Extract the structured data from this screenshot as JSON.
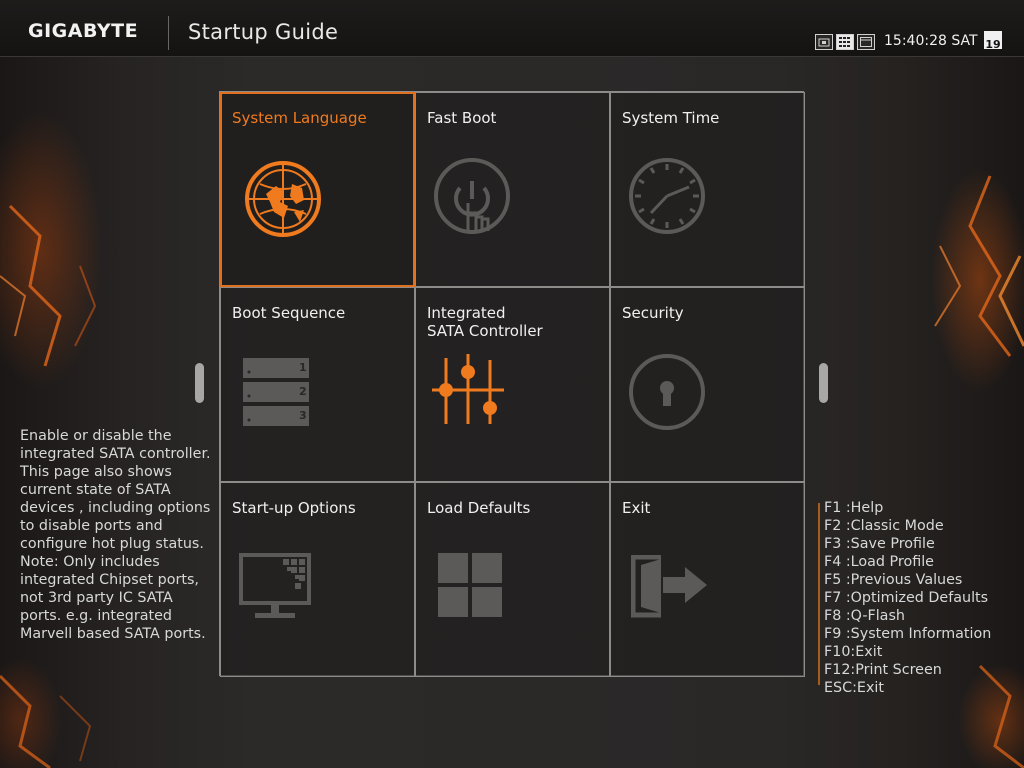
{
  "header": {
    "brand": "GIGABYTE",
    "title": "Startup Guide",
    "time": "15:40:28 SAT",
    "date_day": "19",
    "icons": [
      "screenshot-icon",
      "grid-view-icon",
      "window-view-icon",
      "calendar-icon"
    ]
  },
  "tiles": [
    {
      "label": "System Language",
      "icon": "globe-icon",
      "selected": true
    },
    {
      "label": "Fast Boot",
      "icon": "power-touch-icon",
      "selected": false
    },
    {
      "label": "System Time",
      "icon": "clock-icon",
      "selected": false
    },
    {
      "label": "Boot Sequence",
      "icon": "boot-order-icon",
      "selected": false,
      "items": [
        "1",
        "2",
        "3"
      ]
    },
    {
      "label": "Integrated\nSATA Controller",
      "icon": "sliders-icon",
      "selected": false
    },
    {
      "label": "Security",
      "icon": "lock-icon",
      "selected": false
    },
    {
      "label": "Start-up Options",
      "icon": "monitor-icon",
      "selected": false
    },
    {
      "label": "Load Defaults",
      "icon": "defaults-grid-icon",
      "selected": false
    },
    {
      "label": "Exit",
      "icon": "exit-icon",
      "selected": false
    }
  ],
  "description": [
    "Enable or disable the integrated SATA controller.",
    "This page also shows current state of SATA devices , including options to disable ports and configure hot plug status.",
    "Note: Only includes integrated Chipset ports, not 3rd party IC SATA ports. e.g. integrated Marvell based SATA ports."
  ],
  "hotkeys": [
    "F1 :Help",
    "F2 :Classic Mode",
    "F3 :Save Profile",
    "F4 :Load Profile",
    "F5 :Previous Values",
    "F7 :Optimized Defaults",
    "F8 :Q-Flash",
    "F9 :System Information",
    "F10:Exit",
    "F12:Print Screen",
    "ESC:Exit"
  ],
  "colors": {
    "accent": "#f07a1e",
    "icon_inactive": "#5c5a58",
    "grid_line": "#8e8c8a"
  }
}
